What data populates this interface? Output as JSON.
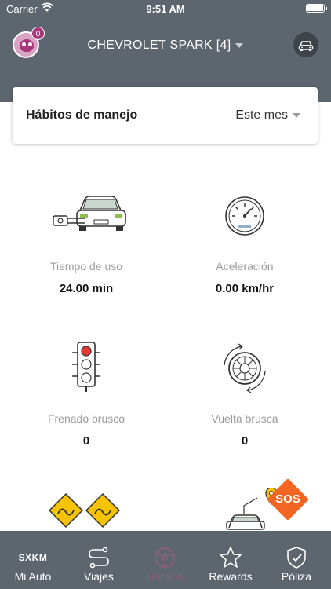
{
  "status_bar": {
    "carrier": "Carrier",
    "time": "9:51 AM"
  },
  "header": {
    "notification_count": "0",
    "vehicle_name": "CHEVROLET SPARK [4]"
  },
  "card": {
    "title": "Hábitos de manejo",
    "period": "Este mes"
  },
  "metrics": [
    {
      "label": "Tiempo de uso",
      "value": "24.00 min",
      "icon": "car-usage-time-icon"
    },
    {
      "label": "Aceleración",
      "value": "0.00 km/hr",
      "icon": "speedometer-icon"
    },
    {
      "label": "Frenado brusco",
      "value": "0",
      "icon": "traffic-light-icon"
    },
    {
      "label": "Vuelta brusca",
      "value": "0",
      "icon": "tire-turn-icon"
    }
  ],
  "sos_label": "SOS",
  "tabs": [
    {
      "label": "Mi Auto",
      "icon_text": "SXKM",
      "active": false
    },
    {
      "label": "Viajes",
      "active": false
    },
    {
      "label": "Hábitos",
      "active": true
    },
    {
      "label": "Rewards",
      "active": false
    },
    {
      "label": "Póliza",
      "active": false
    }
  ],
  "colors": {
    "header_bg": "#5d666e",
    "accent": "#a8387c",
    "sos": "#f26522",
    "road_sign": "#f5c300",
    "active_tab": "#8c6178"
  }
}
